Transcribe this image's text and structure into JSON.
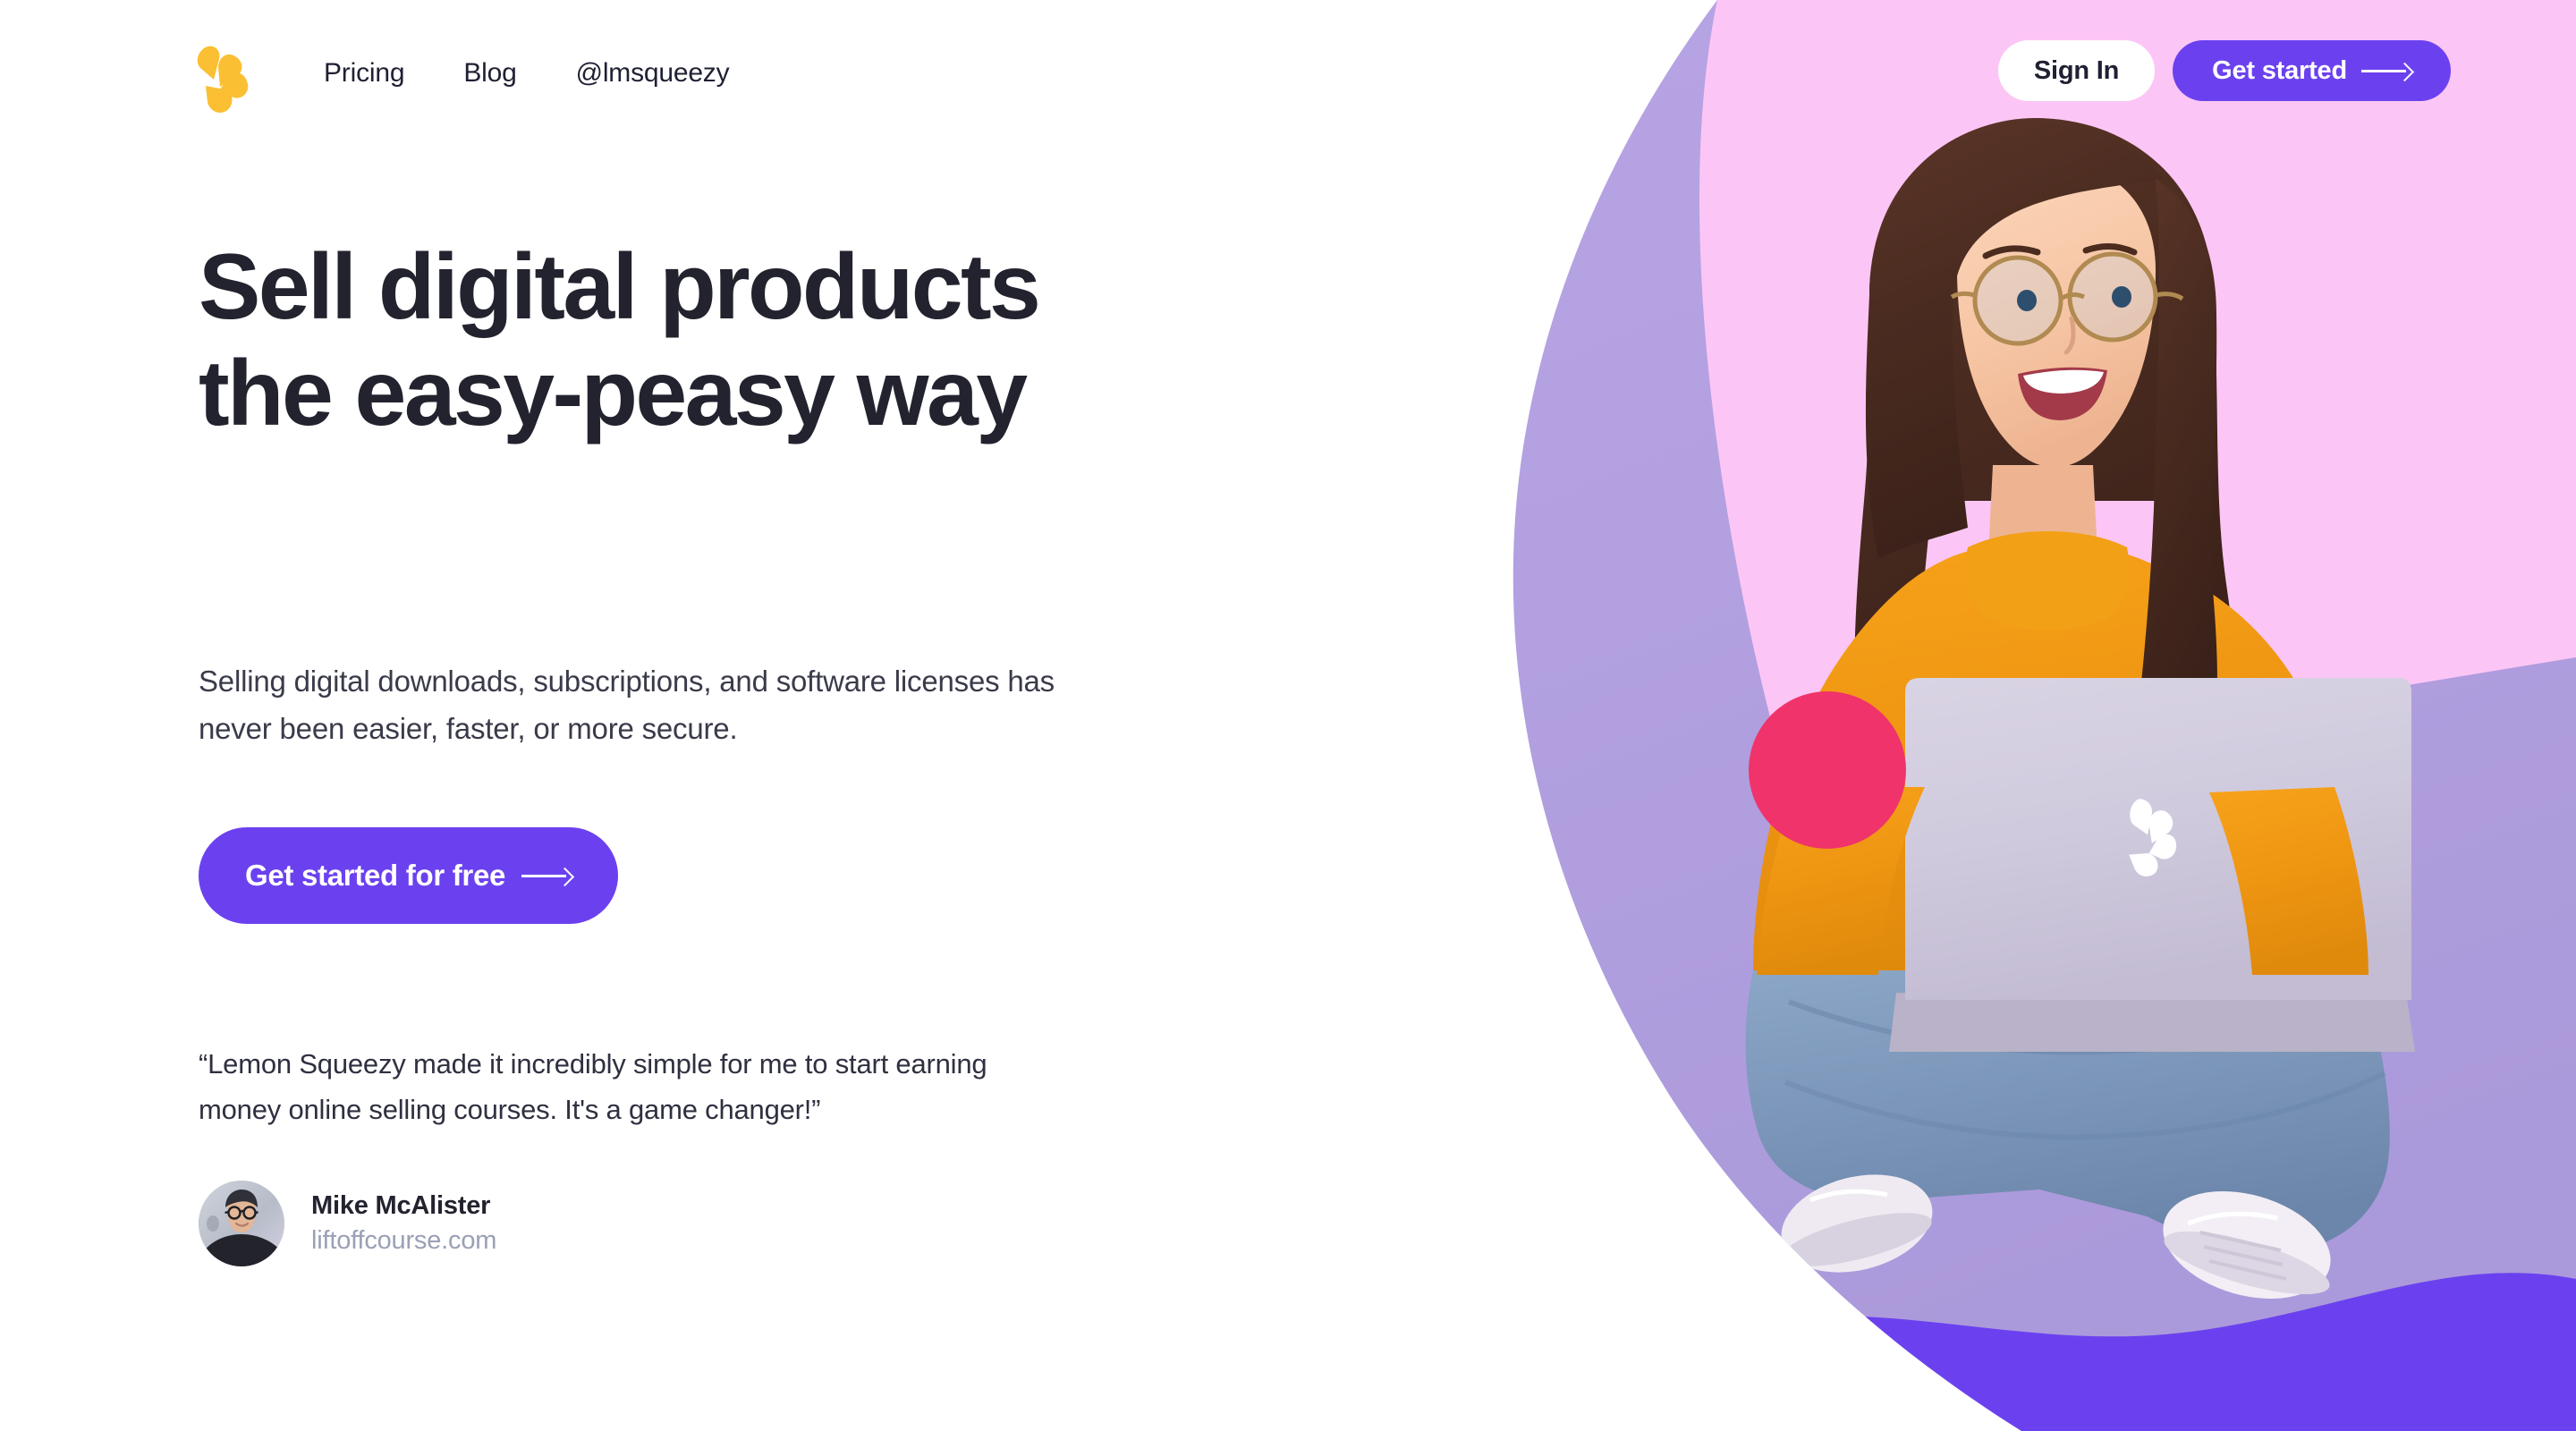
{
  "brand": {
    "logo_icon": "lemon-squeezy-logo-icon",
    "colors": {
      "purple": "#6b41ef",
      "lilac": "#b4a0e0",
      "pink": "#fbc6f5",
      "yellow": "#fcbf31",
      "crimson": "#f0336a",
      "ink": "#22232e",
      "muted": "#9aa0b5"
    }
  },
  "nav": {
    "links": [
      {
        "label": "Pricing"
      },
      {
        "label": "Blog"
      },
      {
        "label": "@lmsqueezy"
      }
    ],
    "sign_in_label": "Sign In",
    "get_started_label": "Get started",
    "arrow_icon": "long-arrow-right-icon"
  },
  "hero": {
    "headline": "Sell digital products the easy-peasy way",
    "subtitle": "Selling digital downloads, subscriptions, and software licenses has never been easier, faster, or more secure.",
    "cta_label": "Get started for free",
    "cta_arrow_icon": "long-arrow-right-icon"
  },
  "testimonial": {
    "quote": "“Lemon Squeezy made it incredibly simple for me to start earning money online selling courses. It's a game changer!”",
    "author_name": "Mike McAlister",
    "author_site": "liftoffcourse.com",
    "avatar_icon": "avatar-photo"
  },
  "photo": {
    "description": "Woman with glasses in orange turtleneck sitting cross-legged with a laptop",
    "laptop_logo_icon": "lemon-squeezy-logo-icon",
    "shapes": [
      {
        "name": "yellow-circle",
        "color": "#fcbf31"
      },
      {
        "name": "crimson-circle",
        "color": "#f0336a"
      },
      {
        "name": "pink-half-circle-right",
        "color": "#fbc6f5"
      },
      {
        "name": "purple-half-circle-bottom",
        "color": "#6b41ef"
      },
      {
        "name": "pink-band-top",
        "color": "#fbc6f5"
      },
      {
        "name": "purple-blob-bottom",
        "color": "#6b41ef"
      }
    ]
  }
}
